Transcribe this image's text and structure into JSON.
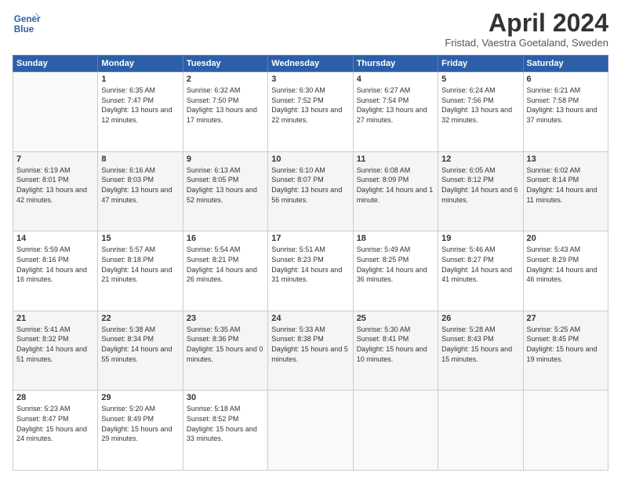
{
  "header": {
    "logo_line1": "General",
    "logo_line2": "Blue",
    "month": "April 2024",
    "location": "Fristad, Vaestra Goetaland, Sweden"
  },
  "days_of_week": [
    "Sunday",
    "Monday",
    "Tuesday",
    "Wednesday",
    "Thursday",
    "Friday",
    "Saturday"
  ],
  "weeks": [
    [
      {
        "day": "",
        "sunrise": "",
        "sunset": "",
        "daylight": "",
        "empty": true
      },
      {
        "day": "1",
        "sunrise": "Sunrise: 6:35 AM",
        "sunset": "Sunset: 7:47 PM",
        "daylight": "Daylight: 13 hours and 12 minutes."
      },
      {
        "day": "2",
        "sunrise": "Sunrise: 6:32 AM",
        "sunset": "Sunset: 7:50 PM",
        "daylight": "Daylight: 13 hours and 17 minutes."
      },
      {
        "day": "3",
        "sunrise": "Sunrise: 6:30 AM",
        "sunset": "Sunset: 7:52 PM",
        "daylight": "Daylight: 13 hours and 22 minutes."
      },
      {
        "day": "4",
        "sunrise": "Sunrise: 6:27 AM",
        "sunset": "Sunset: 7:54 PM",
        "daylight": "Daylight: 13 hours and 27 minutes."
      },
      {
        "day": "5",
        "sunrise": "Sunrise: 6:24 AM",
        "sunset": "Sunset: 7:56 PM",
        "daylight": "Daylight: 13 hours and 32 minutes."
      },
      {
        "day": "6",
        "sunrise": "Sunrise: 6:21 AM",
        "sunset": "Sunset: 7:58 PM",
        "daylight": "Daylight: 13 hours and 37 minutes."
      }
    ],
    [
      {
        "day": "7",
        "sunrise": "Sunrise: 6:19 AM",
        "sunset": "Sunset: 8:01 PM",
        "daylight": "Daylight: 13 hours and 42 minutes."
      },
      {
        "day": "8",
        "sunrise": "Sunrise: 6:16 AM",
        "sunset": "Sunset: 8:03 PM",
        "daylight": "Daylight: 13 hours and 47 minutes."
      },
      {
        "day": "9",
        "sunrise": "Sunrise: 6:13 AM",
        "sunset": "Sunset: 8:05 PM",
        "daylight": "Daylight: 13 hours and 52 minutes."
      },
      {
        "day": "10",
        "sunrise": "Sunrise: 6:10 AM",
        "sunset": "Sunset: 8:07 PM",
        "daylight": "Daylight: 13 hours and 56 minutes."
      },
      {
        "day": "11",
        "sunrise": "Sunrise: 6:08 AM",
        "sunset": "Sunset: 8:09 PM",
        "daylight": "Daylight: 14 hours and 1 minute."
      },
      {
        "day": "12",
        "sunrise": "Sunrise: 6:05 AM",
        "sunset": "Sunset: 8:12 PM",
        "daylight": "Daylight: 14 hours and 6 minutes."
      },
      {
        "day": "13",
        "sunrise": "Sunrise: 6:02 AM",
        "sunset": "Sunset: 8:14 PM",
        "daylight": "Daylight: 14 hours and 11 minutes."
      }
    ],
    [
      {
        "day": "14",
        "sunrise": "Sunrise: 5:59 AM",
        "sunset": "Sunset: 8:16 PM",
        "daylight": "Daylight: 14 hours and 16 minutes."
      },
      {
        "day": "15",
        "sunrise": "Sunrise: 5:57 AM",
        "sunset": "Sunset: 8:18 PM",
        "daylight": "Daylight: 14 hours and 21 minutes."
      },
      {
        "day": "16",
        "sunrise": "Sunrise: 5:54 AM",
        "sunset": "Sunset: 8:21 PM",
        "daylight": "Daylight: 14 hours and 26 minutes."
      },
      {
        "day": "17",
        "sunrise": "Sunrise: 5:51 AM",
        "sunset": "Sunset: 8:23 PM",
        "daylight": "Daylight: 14 hours and 31 minutes."
      },
      {
        "day": "18",
        "sunrise": "Sunrise: 5:49 AM",
        "sunset": "Sunset: 8:25 PM",
        "daylight": "Daylight: 14 hours and 36 minutes."
      },
      {
        "day": "19",
        "sunrise": "Sunrise: 5:46 AM",
        "sunset": "Sunset: 8:27 PM",
        "daylight": "Daylight: 14 hours and 41 minutes."
      },
      {
        "day": "20",
        "sunrise": "Sunrise: 5:43 AM",
        "sunset": "Sunset: 8:29 PM",
        "daylight": "Daylight: 14 hours and 46 minutes."
      }
    ],
    [
      {
        "day": "21",
        "sunrise": "Sunrise: 5:41 AM",
        "sunset": "Sunset: 8:32 PM",
        "daylight": "Daylight: 14 hours and 51 minutes."
      },
      {
        "day": "22",
        "sunrise": "Sunrise: 5:38 AM",
        "sunset": "Sunset: 8:34 PM",
        "daylight": "Daylight: 14 hours and 55 minutes."
      },
      {
        "day": "23",
        "sunrise": "Sunrise: 5:35 AM",
        "sunset": "Sunset: 8:36 PM",
        "daylight": "Daylight: 15 hours and 0 minutes."
      },
      {
        "day": "24",
        "sunrise": "Sunrise: 5:33 AM",
        "sunset": "Sunset: 8:38 PM",
        "daylight": "Daylight: 15 hours and 5 minutes."
      },
      {
        "day": "25",
        "sunrise": "Sunrise: 5:30 AM",
        "sunset": "Sunset: 8:41 PM",
        "daylight": "Daylight: 15 hours and 10 minutes."
      },
      {
        "day": "26",
        "sunrise": "Sunrise: 5:28 AM",
        "sunset": "Sunset: 8:43 PM",
        "daylight": "Daylight: 15 hours and 15 minutes."
      },
      {
        "day": "27",
        "sunrise": "Sunrise: 5:25 AM",
        "sunset": "Sunset: 8:45 PM",
        "daylight": "Daylight: 15 hours and 19 minutes."
      }
    ],
    [
      {
        "day": "28",
        "sunrise": "Sunrise: 5:23 AM",
        "sunset": "Sunset: 8:47 PM",
        "daylight": "Daylight: 15 hours and 24 minutes."
      },
      {
        "day": "29",
        "sunrise": "Sunrise: 5:20 AM",
        "sunset": "Sunset: 8:49 PM",
        "daylight": "Daylight: 15 hours and 29 minutes."
      },
      {
        "day": "30",
        "sunrise": "Sunrise: 5:18 AM",
        "sunset": "Sunset: 8:52 PM",
        "daylight": "Daylight: 15 hours and 33 minutes."
      },
      {
        "day": "",
        "sunrise": "",
        "sunset": "",
        "daylight": "",
        "empty": true
      },
      {
        "day": "",
        "sunrise": "",
        "sunset": "",
        "daylight": "",
        "empty": true
      },
      {
        "day": "",
        "sunrise": "",
        "sunset": "",
        "daylight": "",
        "empty": true
      },
      {
        "day": "",
        "sunrise": "",
        "sunset": "",
        "daylight": "",
        "empty": true
      }
    ]
  ]
}
